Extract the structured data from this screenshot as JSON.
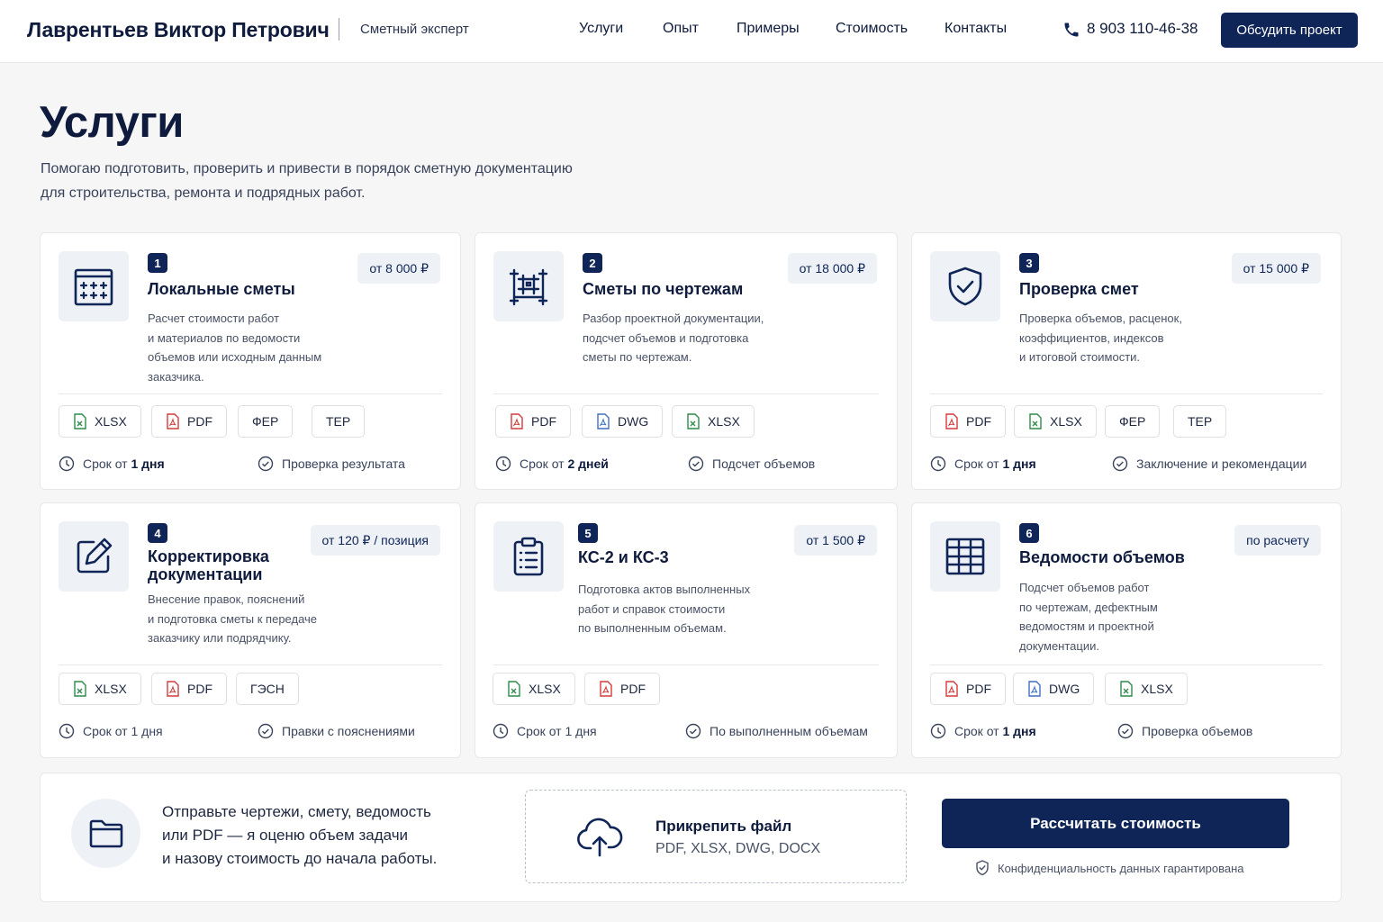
{
  "header": {
    "name": "Лаврентьев Виктор Петрович",
    "role": "Сметный эксперт",
    "nav": [
      "Услуги",
      "Опыт",
      "Примеры",
      "Стоимость",
      "Контакты"
    ],
    "phone": "8 903 110-46-38",
    "cta": "Обсудить проект"
  },
  "hero": {
    "title": "Услуги",
    "desc_line1": "Помогаю подготовить, проверить и привести в порядок сметную документацию",
    "desc_line2": "для строительства, ремонта и подрядных работ."
  },
  "colors": {
    "primary": "#0f2557",
    "text": "#0e1b3d",
    "icon_bg": "#eef2f7",
    "xlsx": "#2e8b4a",
    "pdf": "#d23b3b",
    "dwg": "#3f6fc4"
  },
  "cards": [
    {
      "num": "1",
      "title": "Локальные сметы",
      "price": "от 8 000 ₽",
      "icon": "calculator-grid-icon",
      "desc": [
        "Расчет стоимости работ",
        "и материалов по ведомости",
        "объемов или исходным данным",
        "заказчика."
      ],
      "chips": [
        {
          "label": "XLSX",
          "type": "xlsx"
        },
        {
          "label": "PDF",
          "type": "pdf"
        },
        {
          "label": "ФЕР",
          "type": "text"
        },
        {
          "label": "ТЕР",
          "type": "text"
        }
      ],
      "term_prefix": "Срок от",
      "term_value": "1 дня",
      "check": "Проверка результата"
    },
    {
      "num": "2",
      "title": "Сметы по чертежам",
      "price": "от 18 000 ₽",
      "icon": "blueprint-icon",
      "desc": [
        "Разбор проектной документации,",
        "подсчет объемов и подготовка",
        "сметы по чертежам."
      ],
      "chips": [
        {
          "label": "PDF",
          "type": "pdf"
        },
        {
          "label": "DWG",
          "type": "dwg"
        },
        {
          "label": "XLSX",
          "type": "xlsx"
        }
      ],
      "term_prefix": "Срок от",
      "term_value": "2 дней",
      "check": "Подсчет объемов"
    },
    {
      "num": "3",
      "title": "Проверка смет",
      "price": "от 15 000 ₽",
      "icon": "shield-check-icon",
      "desc": [
        "Проверка объемов, расценок,",
        "коэффициентов, индексов",
        "и итоговой стоимости."
      ],
      "chips": [
        {
          "label": "PDF",
          "type": "pdf"
        },
        {
          "label": "XLSX",
          "type": "xlsx"
        },
        {
          "label": "ФЕР",
          "type": "text"
        },
        {
          "label": "ТЕР",
          "type": "text"
        }
      ],
      "term_prefix": "Срок от",
      "term_value": "1 дня",
      "check": "Заключение и рекомендации"
    },
    {
      "num": "4",
      "title_line1": "Корректировка",
      "title_line2": "документации",
      "price": "от 120 ₽ / позиция",
      "icon": "edit-icon",
      "desc": [
        "Внесение правок, пояснений",
        "и подготовка сметы к передаче",
        "заказчику или подрядчику."
      ],
      "chips": [
        {
          "label": "XLSX",
          "type": "xlsx"
        },
        {
          "label": "PDF",
          "type": "pdf"
        },
        {
          "label": "ГЭСН",
          "type": "text"
        }
      ],
      "term_prefix": "Срок от 1 дня",
      "term_value": "",
      "check": "Правки с пояснениями"
    },
    {
      "num": "5",
      "title": "КС-2 и КС-3",
      "price": "от 1 500 ₽",
      "icon": "clipboard-list-icon",
      "desc": [
        "Подготовка актов выполненных",
        "работ и справок стоимости",
        "по выполненным объемам."
      ],
      "chips": [
        {
          "label": "XLSX",
          "type": "xlsx"
        },
        {
          "label": "PDF",
          "type": "pdf"
        }
      ],
      "term_prefix": "Срок от 1 дня",
      "term_value": "",
      "check": "По выполненным объемам"
    },
    {
      "num": "6",
      "title": "Ведомости объемов",
      "price": "по расчету",
      "icon": "table-grid-icon",
      "desc": [
        "Подсчет объемов работ",
        "по чертежам, дефектным",
        "ведомостям и проектной",
        "документации."
      ],
      "chips": [
        {
          "label": "PDF",
          "type": "pdf"
        },
        {
          "label": "DWG",
          "type": "dwg"
        },
        {
          "label": "XLSX",
          "type": "xlsx"
        }
      ],
      "term_prefix": "Срок от",
      "term_value": "1 дня",
      "check": "Проверка объемов"
    }
  ],
  "bottom": {
    "text_line1": "Отправьте чертежи, смету, ведомость",
    "text_line2": "или PDF — я оценю объем задачи",
    "text_line3": "и назову стоимость до начала работы.",
    "attach_title": "Прикрепить файл",
    "attach_formats": "PDF, XLSX, DWG, DOCX",
    "calc_button": "Рассчитать стоимость",
    "privacy": "Конфиденциальность данных гарантирована"
  }
}
